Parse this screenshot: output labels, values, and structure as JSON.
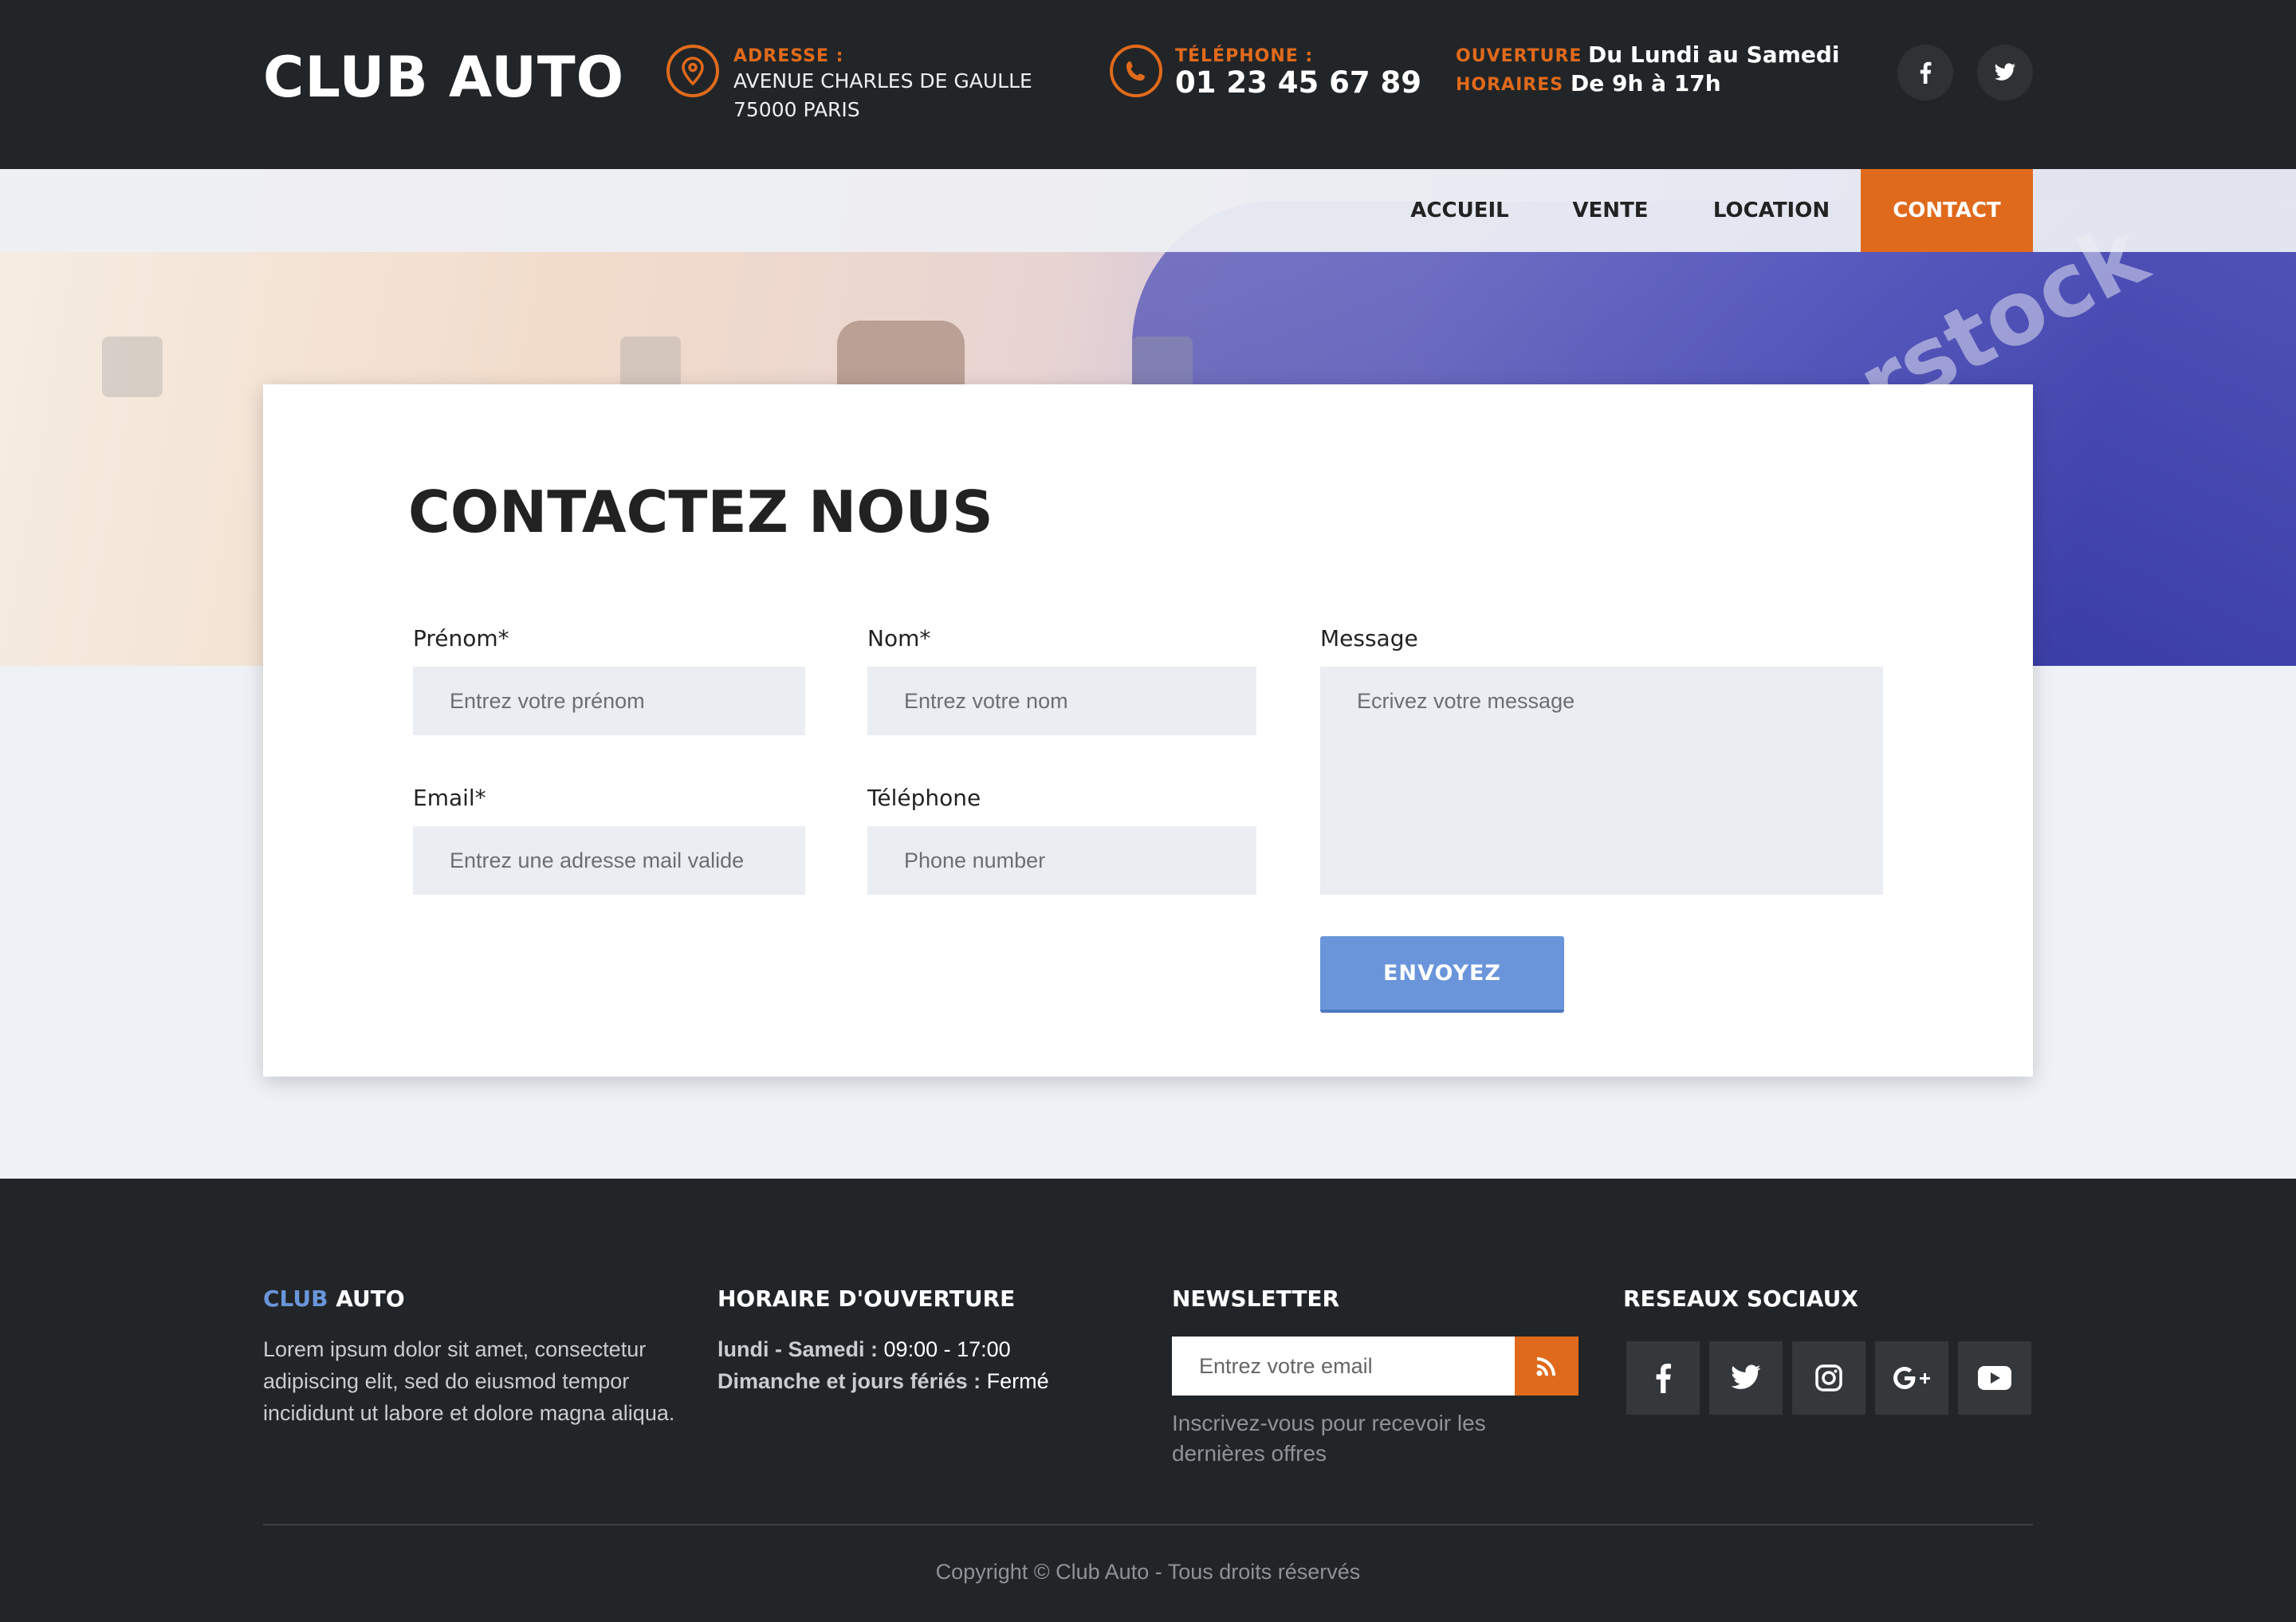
{
  "header": {
    "logo": "CLUB AUTO",
    "address_label": "ADRESSE :",
    "address_line1": "AVENUE CHARLES DE GAULLE",
    "address_line2": "75000 PARIS",
    "phone_label": "TÉLÉPHONE :",
    "phone_number": "01 23 45 67 89",
    "opening_label": "OUVERTURE :",
    "opening_value": "Du Lundi au Samedi",
    "hours_label": "HORAIRES :",
    "hours_value": "De 9h à 17h",
    "social_icons": [
      "facebook-icon",
      "twitter-icon"
    ]
  },
  "nav": {
    "items": [
      {
        "label": "ACCUEIL"
      },
      {
        "label": "VENTE"
      },
      {
        "label": "LOCATION"
      },
      {
        "label": "CONTACT",
        "active": true
      }
    ]
  },
  "hero": {
    "watermark": "shutterstock"
  },
  "contact": {
    "title": "CONTACTEZ NOUS",
    "firstname_label": "Prénom*",
    "firstname_placeholder": "Entrez votre prénom",
    "lastname_label": "Nom*",
    "lastname_placeholder": "Entrez votre nom",
    "email_label": "Email*",
    "email_placeholder": "Entrez une adresse mail valide",
    "phone_label": "Téléphone",
    "phone_placeholder": "Phone number",
    "message_label": "Message",
    "message_placeholder": "Ecrivez votre message",
    "submit_label": "ENVOYEZ"
  },
  "footer": {
    "brand_accent": "CLUB",
    "brand_rest": "AUTO",
    "about_text": "Lorem ipsum dolor sit amet, consectetur adipiscing elit, sed do eiusmod tempor incididunt ut labore et dolore magna aliqua.",
    "hours_title": "HORAIRE D'OUVERTURE",
    "hours_weekdays_label": "lundi - Samedi :",
    "hours_weekdays_value": "09:00 - 17:00",
    "hours_sunday_label": "Dimanche et jours fériés :",
    "hours_sunday_value": "Fermé",
    "newsletter_title": "NEWSLETTER",
    "newsletter_placeholder": "Entrez votre email",
    "newsletter_note": "Inscrivez-vous pour recevoir les dernières offres",
    "social_title": "RESEAUX SOCIAUX",
    "social_icons": [
      "facebook-icon",
      "twitter-icon",
      "instagram-icon",
      "google-plus-icon",
      "youtube-icon"
    ],
    "copyright": "Copyright © Club Auto - Tous droits réservés"
  },
  "colors": {
    "accent_orange": "#e06a1c",
    "accent_blue": "#6a95da",
    "dark_bg": "#222527"
  }
}
